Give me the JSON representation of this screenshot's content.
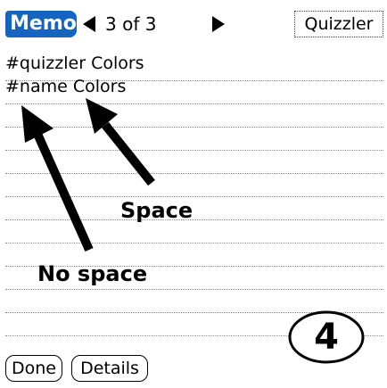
{
  "header": {
    "app_title": "Memo",
    "pager": "3 of 3",
    "category": "Quizzler"
  },
  "memo": {
    "lines": [
      "#quizzler Colors",
      "#name Colors"
    ]
  },
  "annotations": {
    "space_label": "Space",
    "no_space_label": "No space",
    "step_number": "4"
  },
  "buttons": {
    "done": "Done",
    "details": "Details"
  },
  "colors": {
    "title_bar": "#1565c0",
    "text": "#000000"
  },
  "icons": [
    "prev-arrow-icon",
    "next-arrow-icon",
    "annotation-arrow"
  ]
}
